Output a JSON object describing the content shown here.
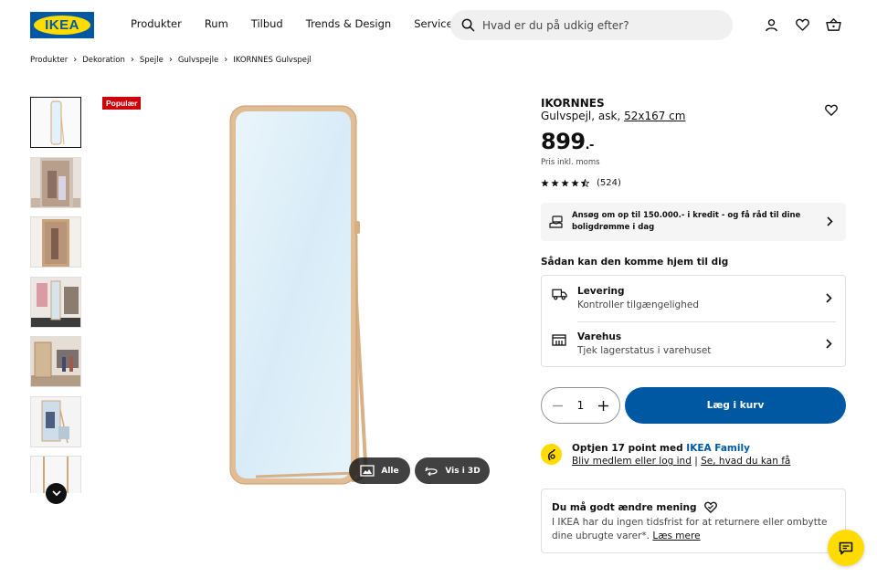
{
  "logo": {
    "text": "IKEA"
  },
  "nav": {
    "items": [
      "Produkter",
      "Rum",
      "Tilbud",
      "Trends & Design",
      "Servicer"
    ]
  },
  "search": {
    "placeholder": "Hvad er du på udkig efter?",
    "value": ""
  },
  "header_icons": [
    "user-icon",
    "heart-icon",
    "cart-icon"
  ],
  "breadcrumb": [
    "Produkter",
    "Dekoration",
    "Spejle",
    "Gulvspejle",
    "IKORNNES Gulvspejl"
  ],
  "gallery": {
    "badge": "Populær",
    "thumbnails": 7,
    "active_thumbnail": 1,
    "buttons": {
      "all": "Alle",
      "view3d": "Vis i 3D"
    }
  },
  "product": {
    "name": "IKORNNES",
    "description": "Gulvspejl, ask,",
    "size": "52x167 cm",
    "price": "899",
    "price_suffix": ".-",
    "price_note": "Pris inkl. moms",
    "rating": 4.5,
    "review_count": "(524)"
  },
  "credit": {
    "text": "Ansøg om op til 150.000.- i kredit - og få råd til dine boligdrømme i dag"
  },
  "delivery": {
    "title": "Sådan kan den komme hjem til dig",
    "options": [
      {
        "title": "Levering",
        "subtitle": "Kontroller tilgængelighed",
        "icon": "truck-icon"
      },
      {
        "title": "Varehus",
        "subtitle": "Tjek lagerstatus i varehuset",
        "icon": "store-icon"
      }
    ]
  },
  "purchase": {
    "quantity": "1",
    "add_to_cart": "Læg i kurv"
  },
  "family": {
    "title_prefix": "Optjen 17 point med ",
    "title_link": "IKEA Family",
    "link1": "Bliv medlem eller log ind",
    "separator": " | ",
    "link2": "Se, hvad du kan få"
  },
  "returns": {
    "title": "Du må godt ændre mening",
    "text": "I IKEA har du ingen tidsfrist for at returnere eller ombytte dine ubrugte varer*. ",
    "link": "Læs mere"
  },
  "colors": {
    "ikea_blue": "#0058a3",
    "ikea_yellow": "#ffdb00",
    "badge_red": "#cc0008"
  }
}
